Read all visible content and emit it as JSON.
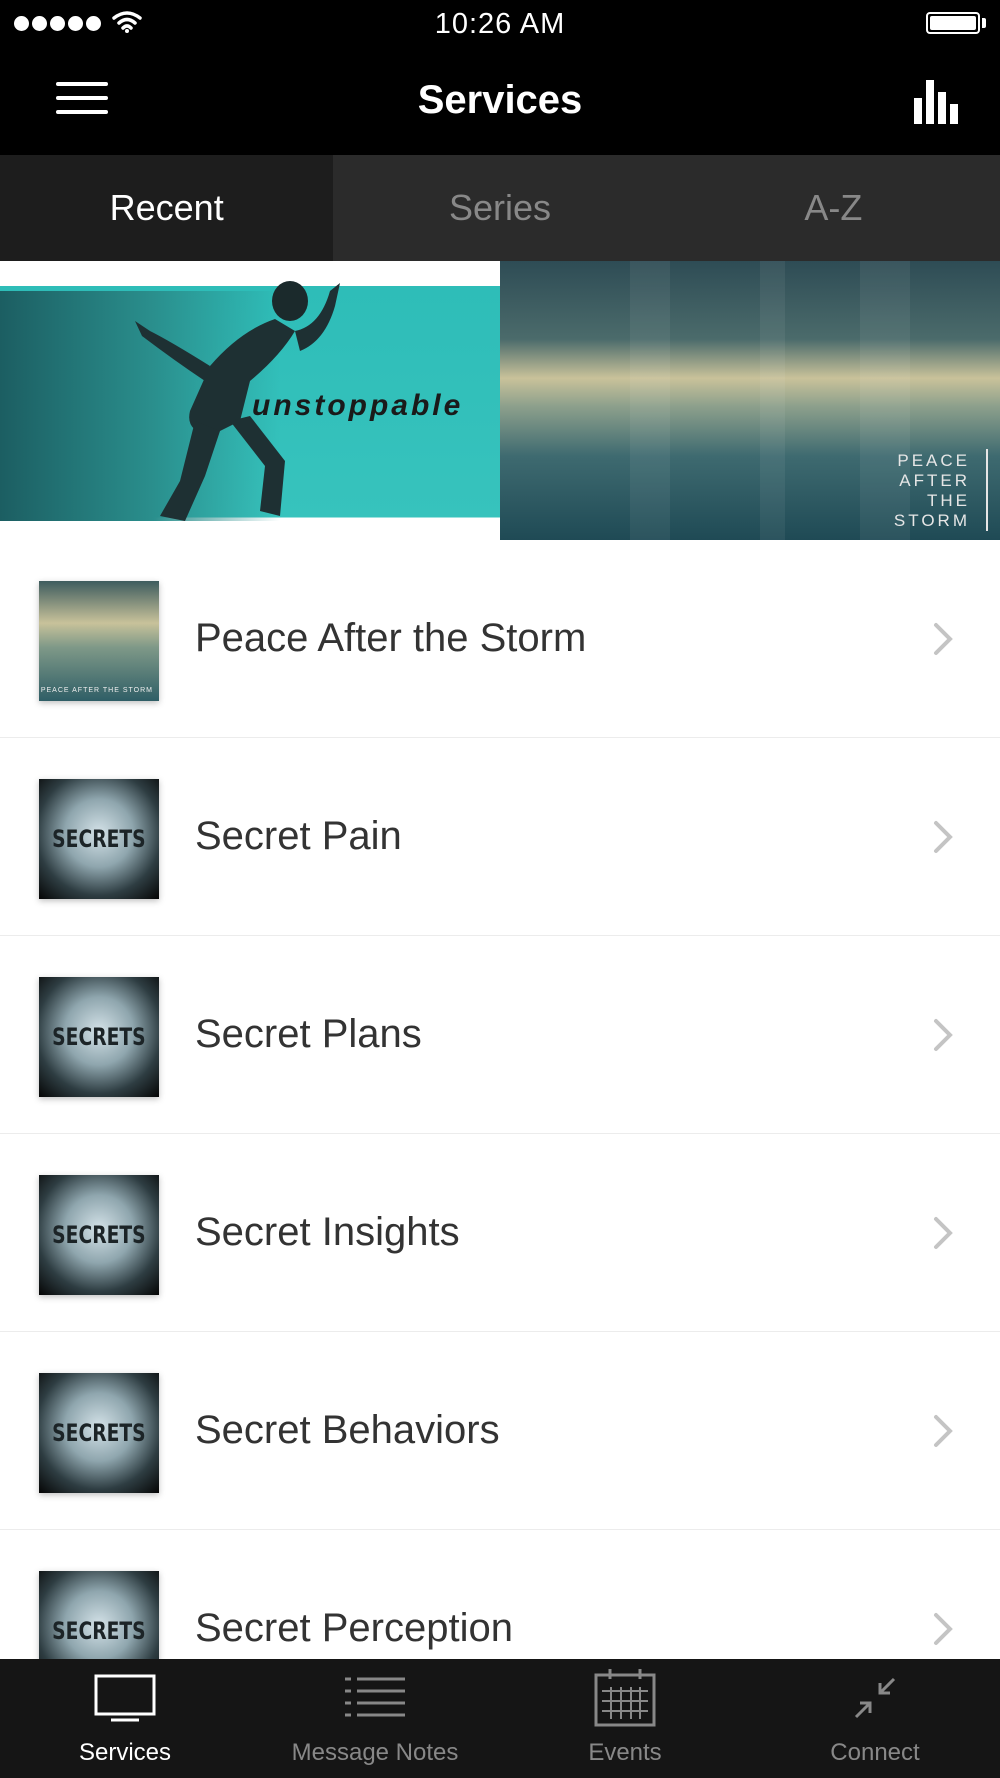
{
  "status_bar": {
    "time": "10:26 AM",
    "signal_bars": 5,
    "battery_level": 1.0
  },
  "header": {
    "title": "Services",
    "menu_icon": "hamburger-menu-icon",
    "action_icon": "bar-chart-icon"
  },
  "tabs": [
    {
      "label": "Recent",
      "active": true
    },
    {
      "label": "Series",
      "active": false
    },
    {
      "label": "A-Z",
      "active": false
    }
  ],
  "banner": {
    "left_text": "unstoppable",
    "right_text_lines": [
      "PEACE",
      "AFTER",
      "THE",
      "STORM"
    ]
  },
  "services": [
    {
      "title": "Peace After the Storm",
      "thumb": "peace",
      "thumb_text": "PEACE AFTER THE STORM"
    },
    {
      "title": "Secret Pain",
      "thumb": "secrets",
      "thumb_text": "SECRETS"
    },
    {
      "title": "Secret Plans",
      "thumb": "secrets",
      "thumb_text": "SECRETS"
    },
    {
      "title": "Secret Insights",
      "thumb": "secrets",
      "thumb_text": "SECRETS"
    },
    {
      "title": "Secret Behaviors",
      "thumb": "secrets",
      "thumb_text": "SECRETS"
    },
    {
      "title": "Secret Perception",
      "thumb": "secrets",
      "thumb_text": "SECRETS"
    }
  ],
  "bottom_tabs": [
    {
      "label": "Services",
      "icon": "tv-icon",
      "active": true
    },
    {
      "label": "Message Notes",
      "icon": "list-icon",
      "active": false
    },
    {
      "label": "Events",
      "icon": "calendar-icon",
      "active": false
    },
    {
      "label": "Connect",
      "icon": "connect-arrows-icon",
      "active": false
    }
  ],
  "colors": {
    "header_bg": "#000000",
    "tab_bg": "#2b2b2b",
    "tab_active_bg": "#1d1d1d",
    "tabbar_bg": "#151515",
    "banner_teal": "#37c3bd"
  }
}
